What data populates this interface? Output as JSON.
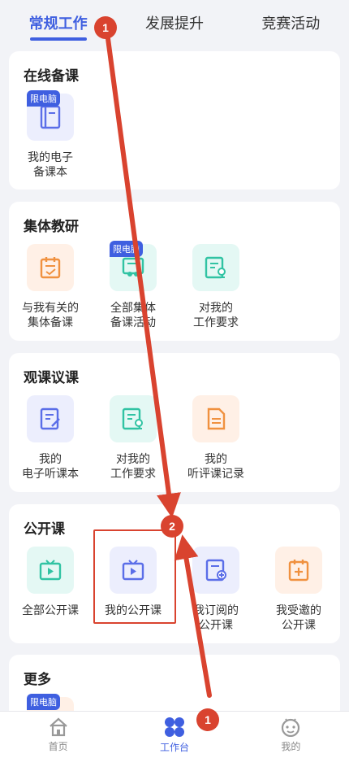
{
  "tabs": [
    {
      "label": "常规工作",
      "active": true
    },
    {
      "label": "发展提升",
      "active": false
    },
    {
      "label": "竞赛活动",
      "active": false
    }
  ],
  "sections": [
    {
      "title": "在线备课",
      "items": [
        {
          "label": "我的电子\n备课本",
          "badge": "限电脑",
          "icon": "book-icon",
          "color": "#5b6ee8"
        }
      ]
    },
    {
      "title": "集体教研",
      "items": [
        {
          "label": "与我有关的\n集体备课",
          "icon": "calendar-check-icon",
          "color": "#f0913f"
        },
        {
          "label": "全部集体\n备课活动",
          "badge": "限电脑",
          "icon": "group-board-icon",
          "color": "#31c3a3"
        },
        {
          "label": "对我的\n工作要求",
          "icon": "certificate-icon",
          "color": "#31c3a3"
        }
      ]
    },
    {
      "title": "观课议课",
      "items": [
        {
          "label": "我的\n电子听课本",
          "icon": "edit-doc-icon",
          "color": "#5b6ee8"
        },
        {
          "label": "对我的\n工作要求",
          "icon": "certificate-icon",
          "color": "#31c3a3"
        },
        {
          "label": "我的\n听评课记录",
          "icon": "document-icon",
          "color": "#f0913f"
        }
      ]
    },
    {
      "title": "公开课",
      "items": [
        {
          "label": "全部公开课",
          "icon": "tv-play-icon",
          "color": "#31c3a3"
        },
        {
          "label": "我的公开课",
          "icon": "tv-play-icon",
          "color": "#5b6ee8"
        },
        {
          "label": "我订阅的\n公开课",
          "icon": "subscribe-doc-icon",
          "color": "#5b6ee8"
        },
        {
          "label": "我受邀的\n公开课",
          "icon": "calendar-plus-icon",
          "color": "#f0913f"
        }
      ]
    },
    {
      "title": "更多",
      "items": [
        {
          "label": "",
          "badge": "限电脑",
          "icon": "hidden-icon",
          "color": "#f0913f"
        }
      ]
    }
  ],
  "bottom_nav": [
    {
      "label": "首页",
      "icon": "home-icon",
      "active": false
    },
    {
      "label": "工作台",
      "icon": "workbench-icon",
      "active": true
    },
    {
      "label": "我的",
      "icon": "profile-face-icon",
      "active": false
    }
  ],
  "annotations": {
    "markers": [
      "1",
      "2",
      "1"
    ],
    "arrow_color": "#d9432f"
  }
}
